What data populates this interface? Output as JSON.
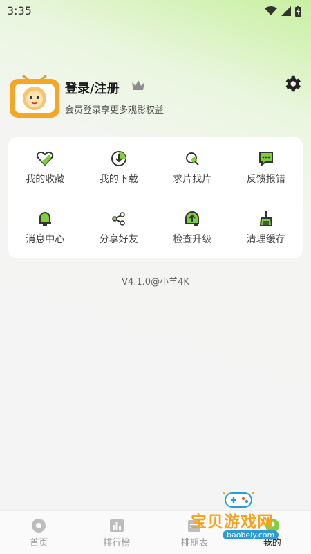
{
  "status_bar": {
    "time": "3:35"
  },
  "profile": {
    "name": "登录/注册",
    "subtitle": "会员登录享更多观影权益"
  },
  "menu": [
    {
      "label": "我的收藏",
      "icon": "heart-icon"
    },
    {
      "label": "我的下载",
      "icon": "download-icon"
    },
    {
      "label": "求片找片",
      "icon": "search-film-icon"
    },
    {
      "label": "反馈报错",
      "icon": "feedback-icon"
    },
    {
      "label": "消息中心",
      "icon": "bell-icon"
    },
    {
      "label": "分享好友",
      "icon": "share-icon"
    },
    {
      "label": "检查升级",
      "icon": "upgrade-icon"
    },
    {
      "label": "清理缓存",
      "icon": "clean-icon"
    }
  ],
  "version": "V4.1.0@小羊4K",
  "tabs": [
    {
      "label": "首页",
      "icon": "home-icon"
    },
    {
      "label": "排行榜",
      "icon": "ranking-icon"
    },
    {
      "label": "排期表",
      "icon": "schedule-icon"
    },
    {
      "label": "我的",
      "icon": "profile-icon"
    }
  ],
  "colors": {
    "accent": "#7fcf3a",
    "watermark": "#f6a31b"
  },
  "watermark": {
    "text": "宝贝游戏网",
    "url": "baobeiy.com"
  }
}
